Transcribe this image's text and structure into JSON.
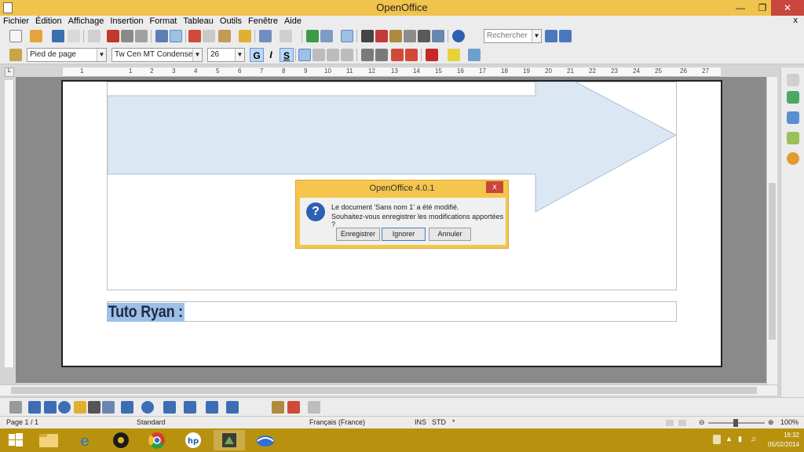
{
  "window": {
    "title": "OpenOffice"
  },
  "menu": {
    "items": [
      "Fichier",
      "Édition",
      "Affichage",
      "Insertion",
      "Format",
      "Tableau",
      "Outils",
      "Fenêtre",
      "Aide"
    ],
    "close": "x"
  },
  "toolbar": {
    "search_placeholder": "Rechercher",
    "paragraph_style": "Pied de page",
    "font_name": "Tw Cen MT Condensed",
    "font_size": "26",
    "bold_label": "G",
    "italic_label": "I",
    "underline_label": "S"
  },
  "ruler": {
    "ticks": [
      "1",
      "1",
      "2",
      "3",
      "4",
      "5",
      "6",
      "7",
      "8",
      "9",
      "10",
      "11",
      "12",
      "13",
      "14",
      "15",
      "16",
      "17",
      "18",
      "19",
      "20",
      "21",
      "22",
      "23",
      "24",
      "25",
      "26",
      "27"
    ],
    "corner": "L"
  },
  "document": {
    "heading": "Tuto Ryan :",
    "arrow_color": "#dbe8f4"
  },
  "dialog": {
    "title": "OpenOffice 4.0.1",
    "close": "x",
    "line1": "Le document 'Sans nom 1' a été modifié.",
    "line2": "Souhaitez-vous enregistrer les modifications apportées ?",
    "buttons": {
      "save": "Enregistrer",
      "ignore": "Ignorer",
      "cancel": "Annuler"
    },
    "icon": "question-icon"
  },
  "status": {
    "page": "Page 1 / 1",
    "style": "Standard",
    "language": "Français (France)",
    "insert_mode": "INS",
    "selection_mode": "STD",
    "modified": "*",
    "zoom": "100%"
  },
  "taskbar": {
    "time": "16:32",
    "date": "05/02/2014",
    "apps": [
      "windows-icon",
      "file-explorer-icon",
      "internet-explorer-icon",
      "media-player-icon",
      "chrome-icon",
      "hp-icon",
      "openoffice-icon",
      "thunderbird-icon"
    ]
  }
}
